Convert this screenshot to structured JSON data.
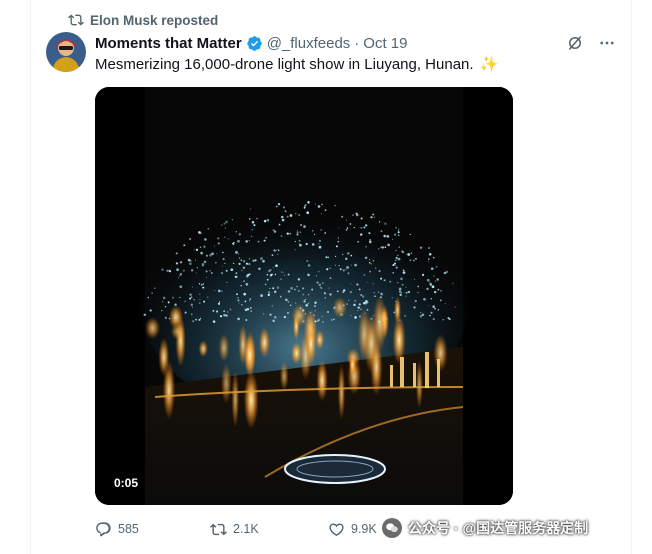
{
  "repost": {
    "label": "Elon Musk reposted"
  },
  "tweet": {
    "display_name": "Moments that Matter",
    "handle": "@_fluxfeeds",
    "separator": "·",
    "date": "Oct 19",
    "text": "Mesmerizing 16,000-drone light show in Liuyang, Hunan.",
    "emoji": "✨",
    "verified": true
  },
  "video": {
    "timestamp": "0:05"
  },
  "actions": {
    "replies": "585",
    "reposts": "2.1K",
    "likes": "9.9K"
  },
  "watermark": {
    "text": "公众号 · @国达管服务器定制"
  },
  "colors": {
    "accent": "#1d9bf0",
    "muted": "#536471",
    "text": "#0f1419"
  }
}
